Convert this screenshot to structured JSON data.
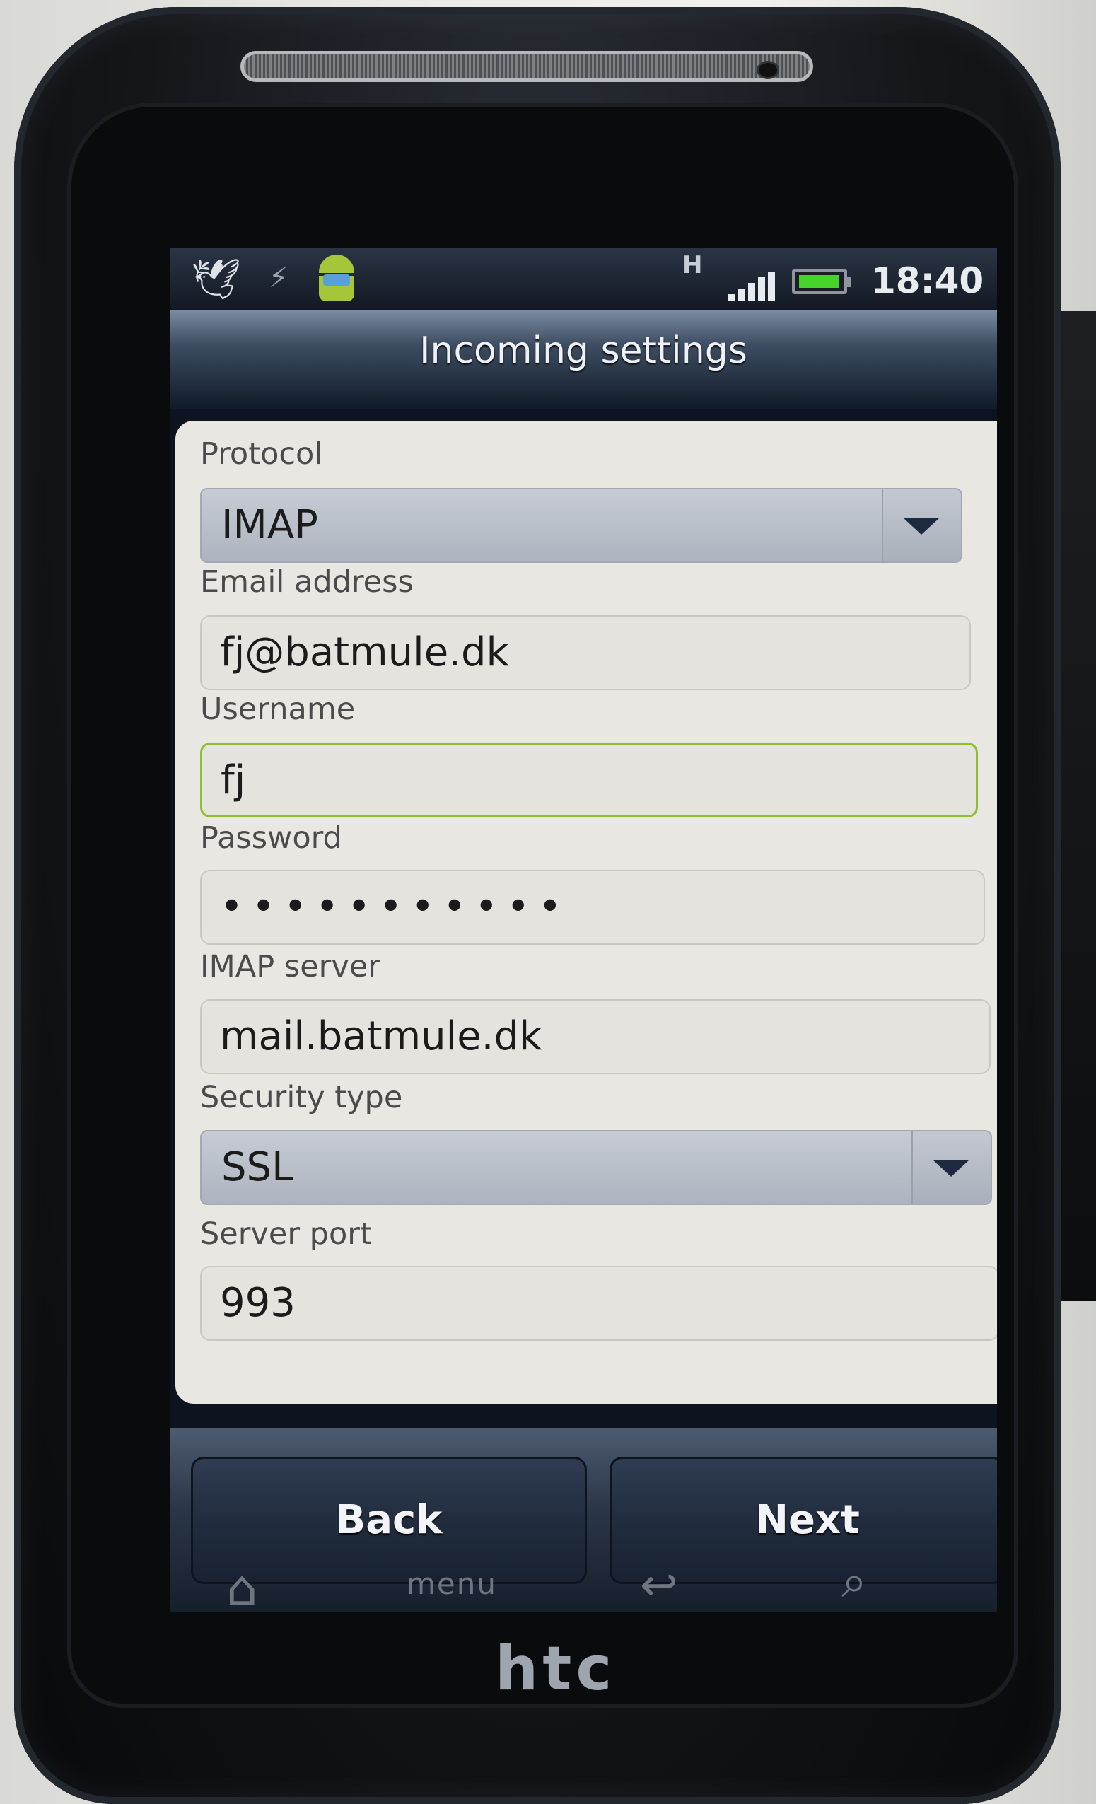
{
  "status_bar": {
    "network_type": "H",
    "time": "18:40"
  },
  "header": {
    "title": "Incoming settings"
  },
  "form": {
    "protocol": {
      "label": "Protocol",
      "value": "IMAP"
    },
    "email": {
      "label": "Email address",
      "value": "fj@batmule.dk"
    },
    "username": {
      "label": "Username",
      "value": "fj"
    },
    "password": {
      "label": "Password",
      "value": "•••••••••••"
    },
    "imap_server": {
      "label": "IMAP server",
      "value": "mail.batmule.dk"
    },
    "security_type": {
      "label": "Security type",
      "value": "SSL"
    },
    "server_port": {
      "label": "Server port",
      "value": "993"
    }
  },
  "buttons": {
    "back": "Back",
    "next": "Next"
  },
  "hardware_keys": {
    "menu": "menu"
  },
  "device": {
    "brand": "htc"
  },
  "colors": {
    "focus_border": "#8fbf2e",
    "battery": "#45d42a"
  },
  "icons": [
    "bird-icon",
    "usb-icon",
    "android-icon",
    "signal-icon",
    "battery-icon",
    "dropdown-arrow-icon",
    "home-icon",
    "back-arrow-icon",
    "search-icon"
  ]
}
